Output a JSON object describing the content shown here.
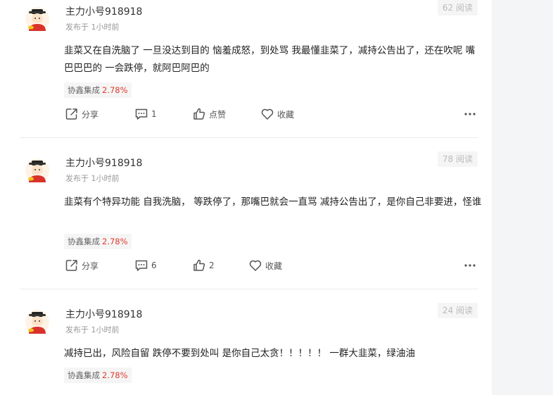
{
  "posts": [
    {
      "username": "主力小号918918",
      "time": "发布于 1小时前",
      "views": "62 阅读",
      "content": "韭菜又在自洗脑了 一旦没达到目的 恼羞成怒，到处骂 我最懂韭菜了，减持公告出了，还在吹呢 嘴巴巴巴的 一会跌停，就阿巴阿巴的",
      "stock_name": "协鑫集成",
      "stock_change": "2.78%",
      "share_label": "分享",
      "comment_count": "1",
      "like_label": "点赞",
      "collect_label": "收藏"
    },
    {
      "username": "主力小号918918",
      "time": "发布于 1小时前",
      "views": "78 阅读",
      "content": "韭菜有个特异功能 自我洗脑， 等跌停了，那嘴巴就会一直骂 减持公告出了，是你自己非要进，怪谁",
      "stock_name": "协鑫集成",
      "stock_change": "2.78%",
      "share_label": "分享",
      "comment_count": "6",
      "like_label": "2",
      "collect_label": "收藏"
    },
    {
      "username": "主力小号918918",
      "time": "发布于 1小时前",
      "views": "24 阅读",
      "content": "减持已出，风险自留 跌停不要到处叫 是你自己太贪！！！！！ 一群大韭菜，绿油油",
      "stock_name": "协鑫集成",
      "stock_change": "2.78%"
    }
  ],
  "colors": {
    "stock_change": "#e03b2e",
    "gutter": "#f4f5f7",
    "divider": "#ececec"
  },
  "icons": [
    "avatar-fortune-god",
    "share-icon",
    "comment-icon",
    "like-icon",
    "heart-icon",
    "more-icon"
  ]
}
